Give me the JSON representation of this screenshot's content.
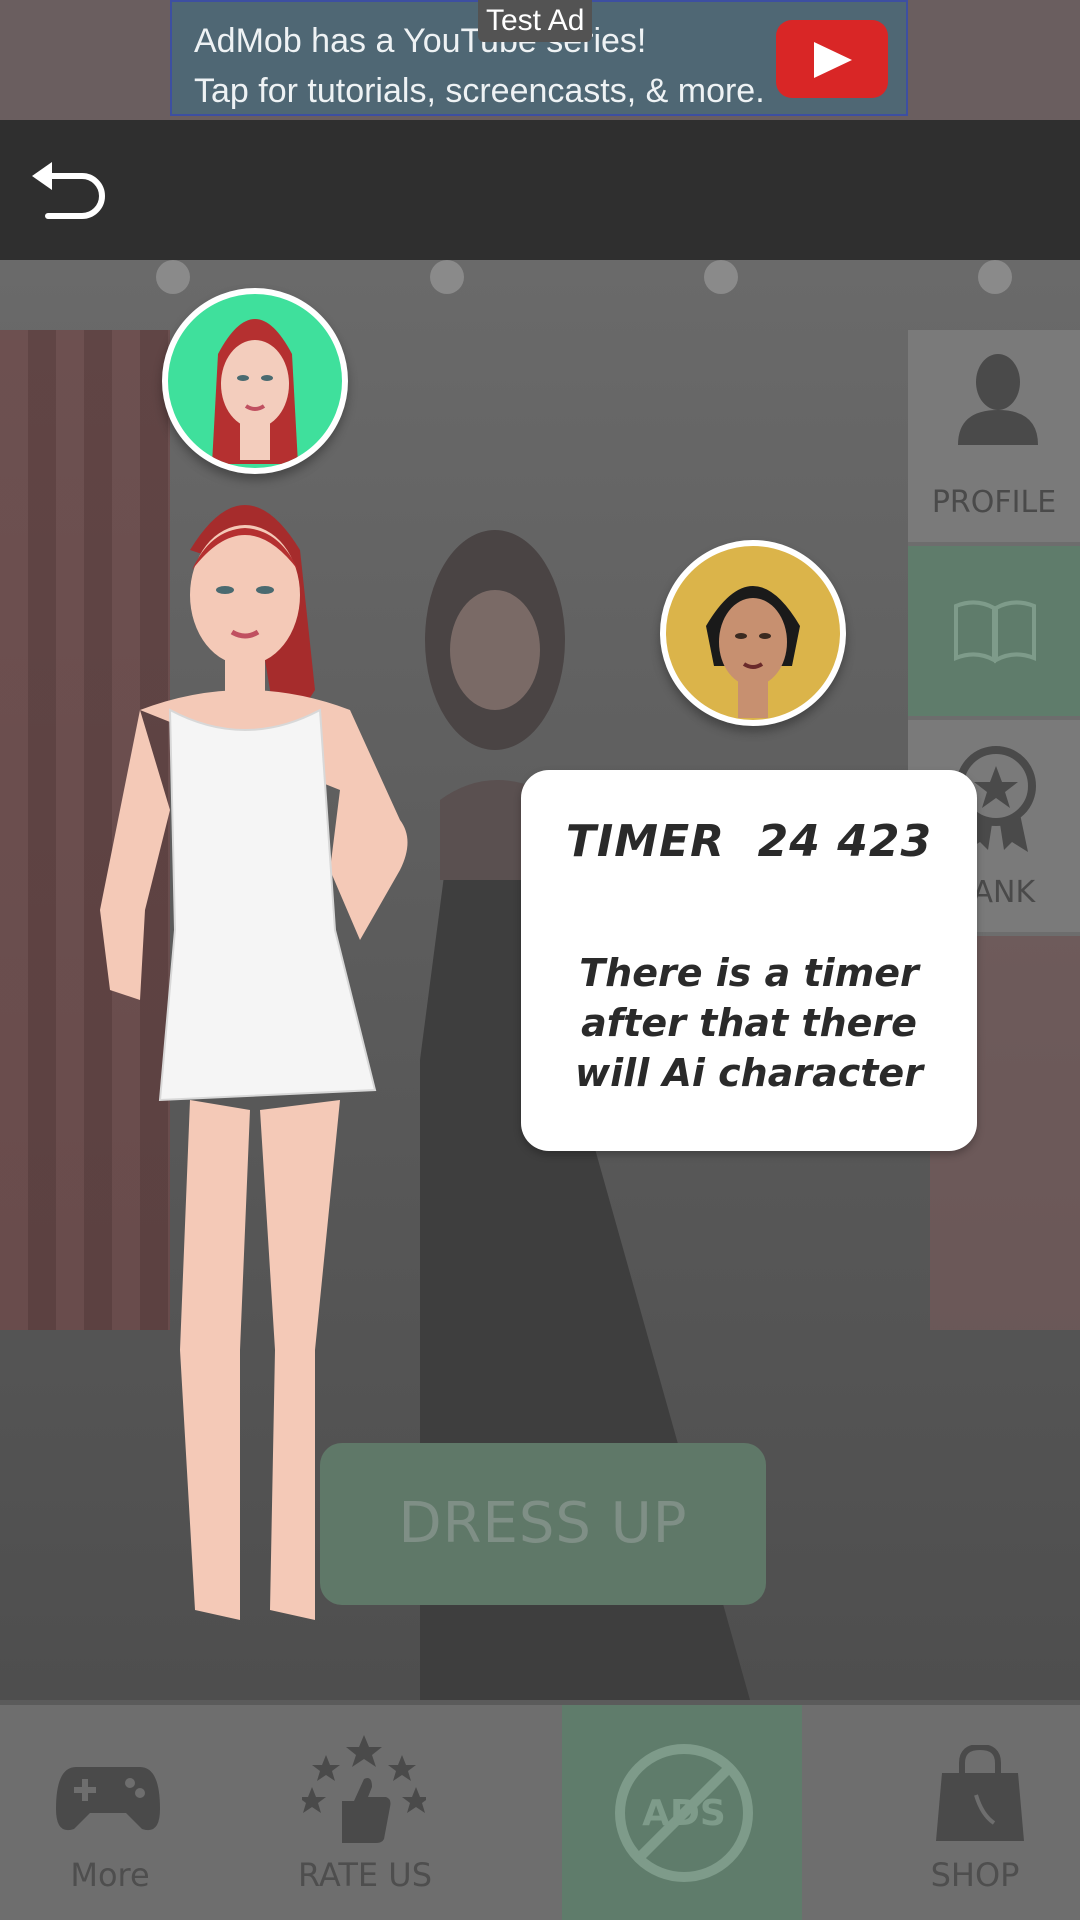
{
  "ad": {
    "line1": "AdMob has a YouTube series!",
    "line2": "Tap for tutorials, screencasts, & more.",
    "badge": "Test Ad"
  },
  "side_menu": {
    "profile": "PROFILE",
    "rank": "RANK"
  },
  "tooltip": {
    "title": "TIMER  24 423",
    "body": "There is a timer after that there will Ai character"
  },
  "dress_up": "DRESS UP",
  "bottom_nav": {
    "more": "More",
    "rate": "RATE US",
    "shop": "SHOP"
  },
  "colors": {
    "accent_green": "#5f7c6b",
    "avatar1_bg": "#3fe09c",
    "avatar2_bg": "#dbb44a",
    "youtube_red": "#d92626"
  }
}
